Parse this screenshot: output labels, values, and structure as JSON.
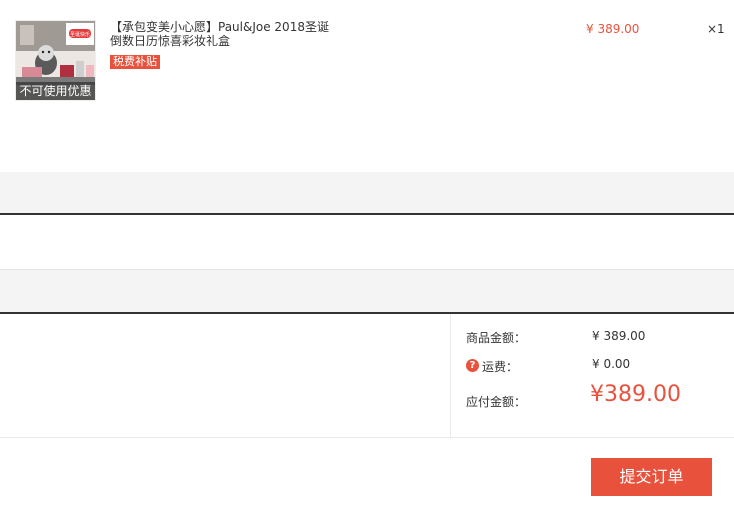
{
  "product": {
    "title_line1": "【承包变美小心愿】Paul&Joe 2018圣诞",
    "title_line2": "倒数日历惊喜彩妆礼盒",
    "tax_badge": "税费补贴",
    "coupon_note": "不可使用优惠",
    "unit_price": "¥ 389.00",
    "quantity": "×1",
    "thumb_sign": "圣诞快乐"
  },
  "summary": {
    "goods_label": "商品金额：",
    "goods_value": "¥ 389.00",
    "shipping_label": "运费：",
    "shipping_value": "¥ 0.00",
    "help_icon_glyph": "?",
    "payable_label": "应付金额：",
    "payable_value": "¥389.00"
  },
  "actions": {
    "submit_label": "提交订单"
  },
  "colors": {
    "accent": "#e8523c",
    "band": "#f4f4f4",
    "divider": "#333333"
  }
}
